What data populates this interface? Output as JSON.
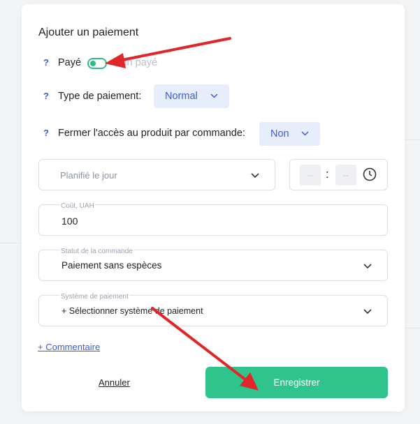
{
  "modal": {
    "title": "Ajouter un paiement",
    "help_glyph": "?",
    "paid": {
      "on_label": "Payé",
      "off_label": "Non payé",
      "checked": true
    },
    "payment_type": {
      "label": "Type de paiement:",
      "value": "Normal"
    },
    "close_access": {
      "label": "Fermer l'accès au produit par commande:",
      "value": "Non"
    },
    "schedule": {
      "date_placeholder": "Planifié le jour",
      "hours_placeholder": "--",
      "minutes_placeholder": "--",
      "separator": ":"
    },
    "cost": {
      "legend": "Coût, UAH",
      "value": "100"
    },
    "order_status": {
      "legend": "Statut de la commande",
      "value": "Paiement sans espèces"
    },
    "payment_system": {
      "legend": "Système de paiement",
      "value": "+ Sélectionner système de paiement"
    },
    "comment_link": "+ Commentaire",
    "cancel_label": "Annuler",
    "save_label": "Enregistrer"
  },
  "colors": {
    "accent_green": "#2ec48c",
    "accent_blue": "#3b5bdb",
    "annotation_arrow": "#e0262a"
  },
  "icons": [
    "toggle-switch",
    "chevron-down-icon",
    "clock-icon",
    "red-arrow-annotation"
  ]
}
